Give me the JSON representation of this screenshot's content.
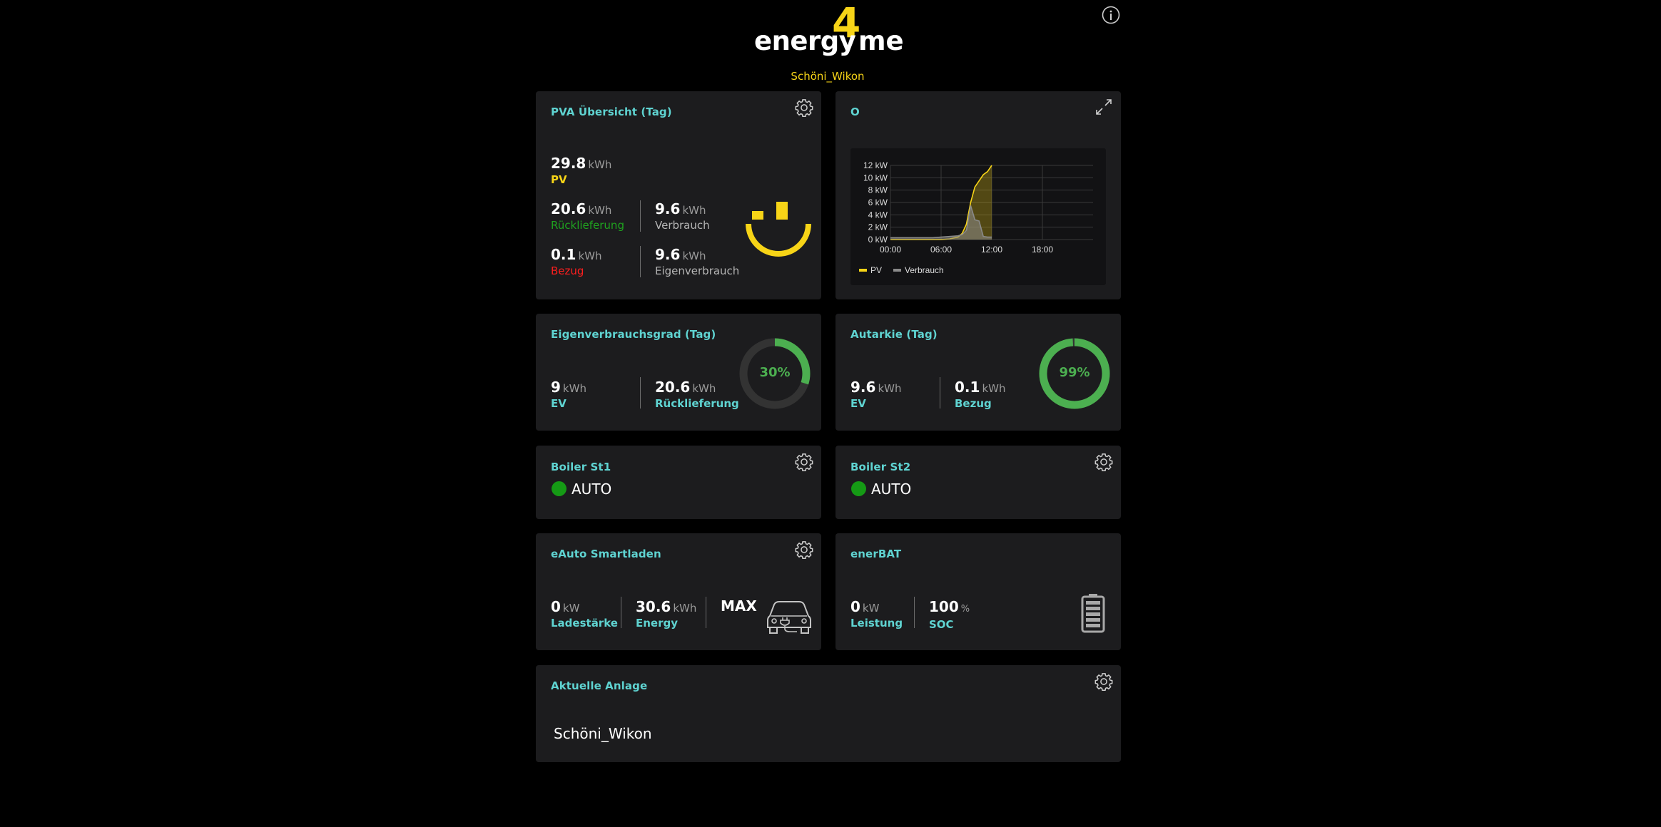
{
  "header": {
    "logo_text_left": "energy",
    "logo_digit": "4",
    "logo_text_right": "me",
    "subtitle": "Schöni_Wikon"
  },
  "pva": {
    "title": "PVA Übersicht (Tag)",
    "pv": {
      "value": "29.8",
      "unit": "kWh",
      "label": "PV"
    },
    "rueck": {
      "value": "20.6",
      "unit": "kWh",
      "label": "Rücklieferung"
    },
    "verbrauch": {
      "value": "9.6",
      "unit": "kWh",
      "label": "Verbrauch"
    },
    "bezug": {
      "value": "0.1",
      "unit": "kWh",
      "label": "Bezug"
    },
    "eigen": {
      "value": "9.6",
      "unit": "kWh",
      "label": "Eigenverbrauch"
    }
  },
  "chart_card": {
    "title": "O",
    "chart_data": {
      "type": "area",
      "x": [
        "00:00",
        "01:00",
        "02:00",
        "03:00",
        "04:00",
        "05:00",
        "06:00",
        "07:00",
        "08:00",
        "08:30",
        "09:00",
        "09:30",
        "10:00",
        "10:30",
        "11:00",
        "11:30",
        "12:00"
      ],
      "series": [
        {
          "name": "PV",
          "color": "#f7d417",
          "values": [
            0,
            0,
            0,
            0,
            0,
            0,
            0,
            0.1,
            0.4,
            1.0,
            2.5,
            6.0,
            8.5,
            9.5,
            10.5,
            11.0,
            12.0
          ]
        },
        {
          "name": "Verbrauch",
          "color": "#8a8a8a",
          "values": [
            0.3,
            0.3,
            0.3,
            0.3,
            0.3,
            0.3,
            0.4,
            0.5,
            0.6,
            0.8,
            1.5,
            5.5,
            3.2,
            3.0,
            0.5,
            0.4,
            0.4
          ]
        }
      ],
      "ylim": [
        0,
        12
      ],
      "yticks": [
        "0 kW",
        "2 kW",
        "4 kW",
        "6 kW",
        "8 kW",
        "10 kW",
        "12 kW"
      ],
      "xticks": [
        "00:00",
        "06:00",
        "12:00",
        "18:00"
      ],
      "xlim_hours": [
        0,
        24
      ],
      "legend": [
        "PV",
        "Verbrauch"
      ],
      "grid": true
    }
  },
  "eigenverbrauchsgrad": {
    "title": "Eigenverbrauchsgrad (Tag)",
    "ev": {
      "value": "9",
      "unit": "kWh",
      "label": "EV"
    },
    "rueck": {
      "value": "20.6",
      "unit": "kWh",
      "label": "Rücklieferung"
    },
    "percent_text": "30%",
    "percent": 30
  },
  "autarkie": {
    "title": "Autarkie (Tag)",
    "ev": {
      "value": "9.6",
      "unit": "kWh",
      "label": "EV"
    },
    "bezug": {
      "value": "0.1",
      "unit": "kWh",
      "label": "Bezug"
    },
    "percent_text": "99%",
    "percent": 99
  },
  "boiler1": {
    "title": "Boiler St1",
    "status": "AUTO"
  },
  "boiler2": {
    "title": "Boiler St2",
    "status": "AUTO"
  },
  "eauto": {
    "title": "eAuto Smartladen",
    "ladestaerke": {
      "value": "0",
      "unit": "kW",
      "label": "Ladestärke"
    },
    "energy": {
      "value": "30.6",
      "unit": "kWh",
      "label": "Energy"
    },
    "mode": "MAX"
  },
  "enerbat": {
    "title": "enerBAT",
    "leistung": {
      "value": "0",
      "unit": "kW",
      "label": "Leistung"
    },
    "soc": {
      "value": "100",
      "unit": "%",
      "label": "SOC"
    }
  },
  "anlage": {
    "title": "Aktuelle Anlage",
    "name": "Schöni_Wikon"
  },
  "colors": {
    "accent": "#5fd3d1",
    "yellow": "#f7d417",
    "green": "#4caf50",
    "card": "#1c1c1e"
  }
}
